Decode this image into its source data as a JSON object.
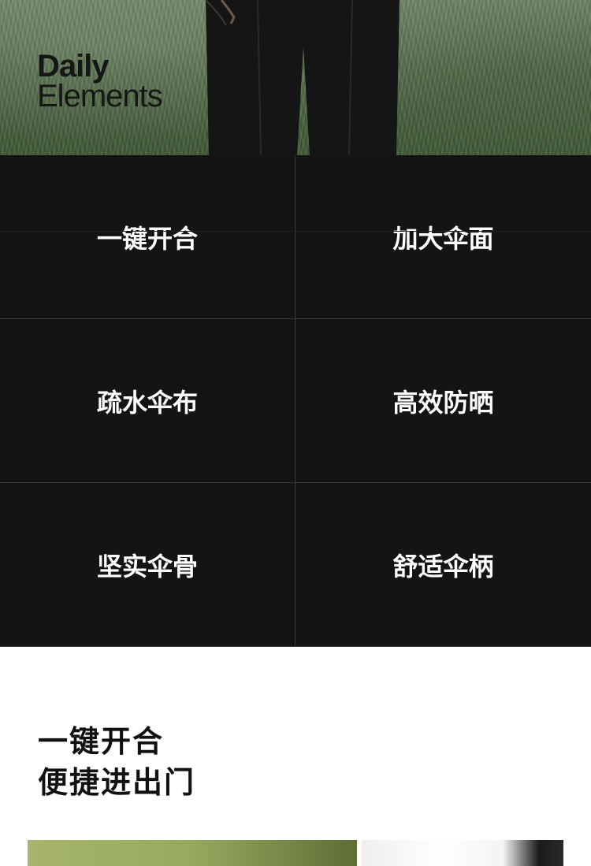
{
  "hero": {
    "brand_line1": "Daily",
    "brand_line2": "Elements"
  },
  "features": [
    {
      "label": "一键开合"
    },
    {
      "label": "加大伞面"
    },
    {
      "label": "疏水伞布"
    },
    {
      "label": "高效防晒"
    },
    {
      "label": "坚实伞骨"
    },
    {
      "label": "舒适伞柄"
    }
  ],
  "section": {
    "title_line1": "一键开合",
    "title_line2": "便捷进出门"
  },
  "colors": {
    "feature_bg": "#141414",
    "feature_text": "#ffffff",
    "grid_line": "#3a3a3a",
    "heading_text": "#111111"
  }
}
